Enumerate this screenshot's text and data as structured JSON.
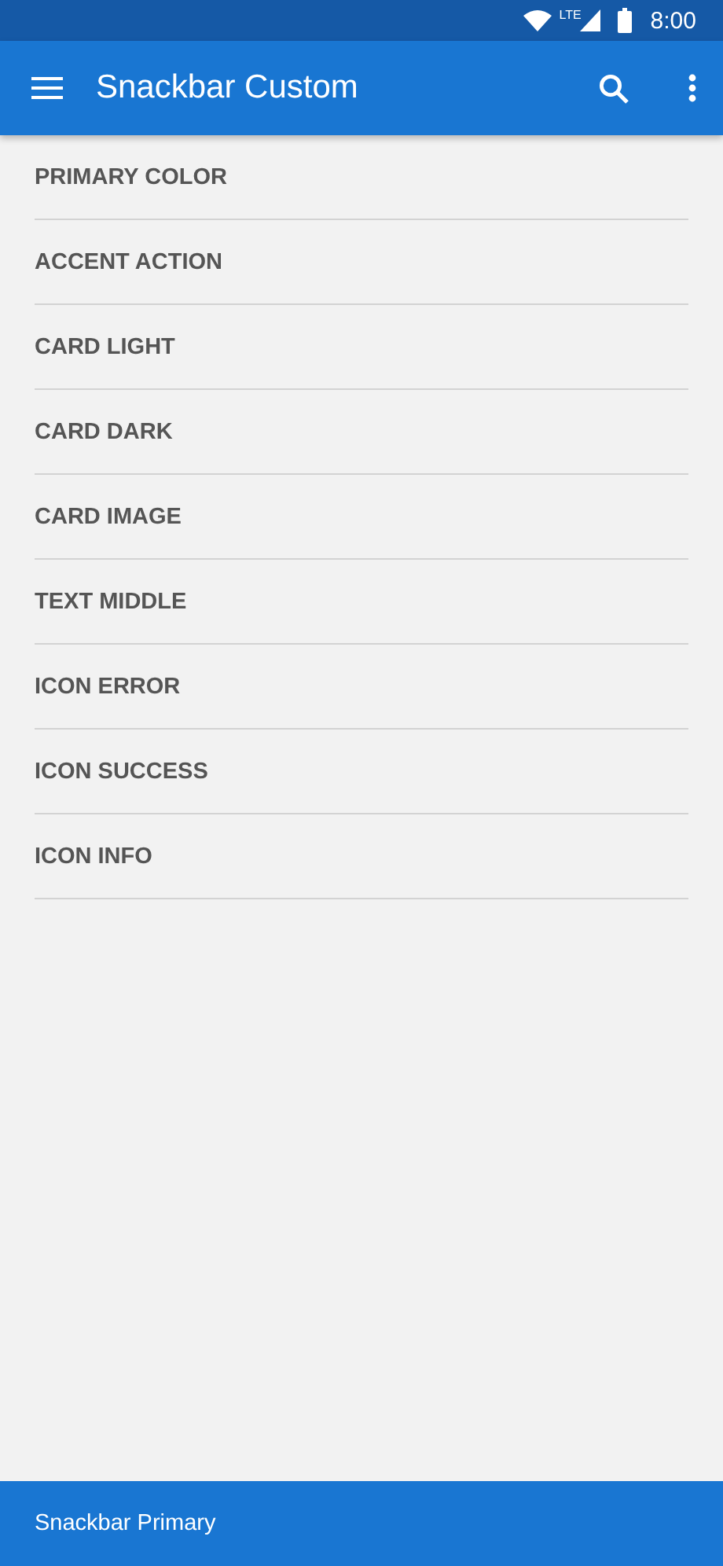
{
  "status_bar": {
    "time": "8:00",
    "network": "LTE"
  },
  "app_bar": {
    "title": "Snackbar Custom"
  },
  "items": [
    {
      "label": "PRIMARY COLOR"
    },
    {
      "label": "ACCENT ACTION"
    },
    {
      "label": "CARD LIGHT"
    },
    {
      "label": "CARD DARK"
    },
    {
      "label": "CARD IMAGE"
    },
    {
      "label": "TEXT MIDDLE"
    },
    {
      "label": "ICON ERROR"
    },
    {
      "label": "ICON SUCCESS"
    },
    {
      "label": "ICON INFO"
    }
  ],
  "snackbar": {
    "message": "Snackbar Primary"
  }
}
